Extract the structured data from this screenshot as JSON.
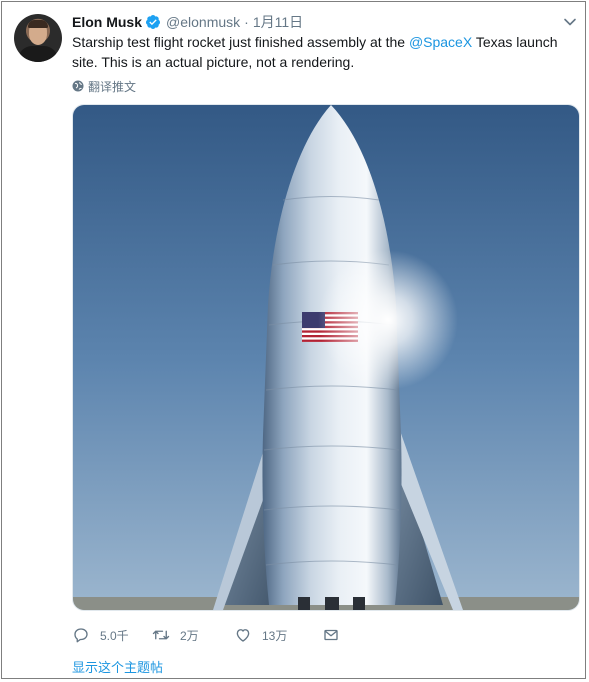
{
  "tweet": {
    "author_name": "Elon Musk",
    "author_handle": "@elonmusk",
    "separator": "·",
    "date": "1月11日",
    "text_before": "Starship test flight rocket just finished assembly at the ",
    "mention": "@SpaceX",
    "text_after": " Texas launch site. This is an actual picture, not a rendering.",
    "translate_label": "翻译推文",
    "replies": "5.0千",
    "retweets": "2万",
    "likes": "13万",
    "show_thread_label": "显示这个主题帖"
  },
  "icons": {
    "verified": "verified-badge-icon",
    "caret": "chevron-down-icon",
    "translate": "globe-icon",
    "reply": "reply-icon",
    "retweet": "retweet-icon",
    "like": "heart-icon",
    "share": "mail-icon"
  },
  "colors": {
    "accent": "#1b95e0",
    "muted": "#657786",
    "text": "#14171a"
  }
}
